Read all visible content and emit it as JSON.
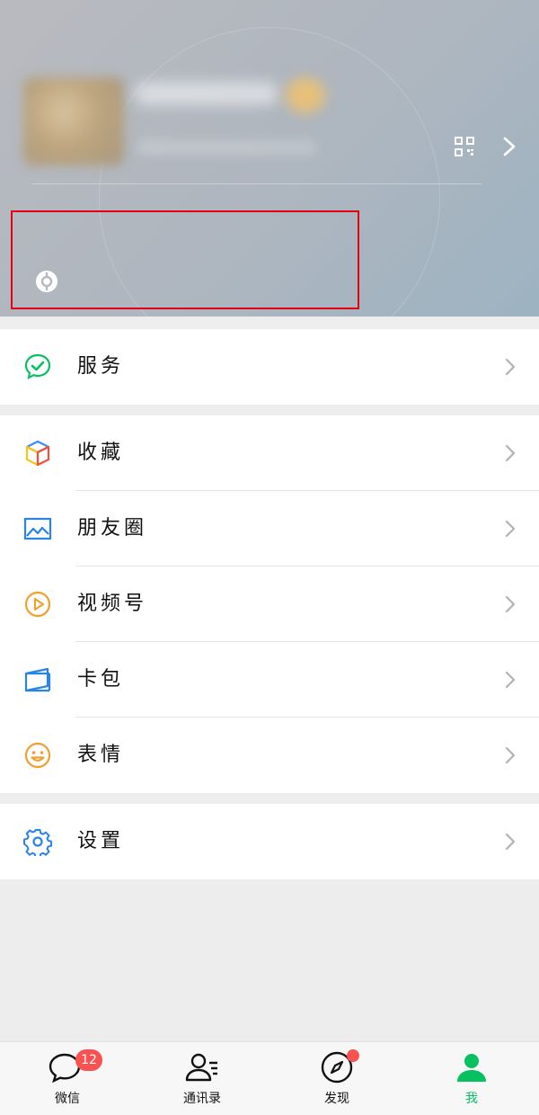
{
  "menu": {
    "services": {
      "label": "服务",
      "icon": "services-icon"
    },
    "favorites": {
      "label": "收藏",
      "icon": "favorites-icon"
    },
    "moments": {
      "label": "朋友圈",
      "icon": "moments-icon"
    },
    "channels": {
      "label": "视频号",
      "icon": "channels-icon"
    },
    "cards": {
      "label": "卡包",
      "icon": "card-wallet-icon"
    },
    "stickers": {
      "label": "表情",
      "icon": "stickers-icon"
    },
    "settings": {
      "label": "设置",
      "icon": "settings-icon"
    }
  },
  "tabbar": {
    "chats": {
      "label": "微信",
      "badge": "12"
    },
    "contacts": {
      "label": "通讯录"
    },
    "discover": {
      "label": "发现"
    },
    "me": {
      "label": "我"
    }
  },
  "colors": {
    "accent": "#07c160",
    "badge": "#fa5151",
    "highlight_box": "#e60012"
  }
}
